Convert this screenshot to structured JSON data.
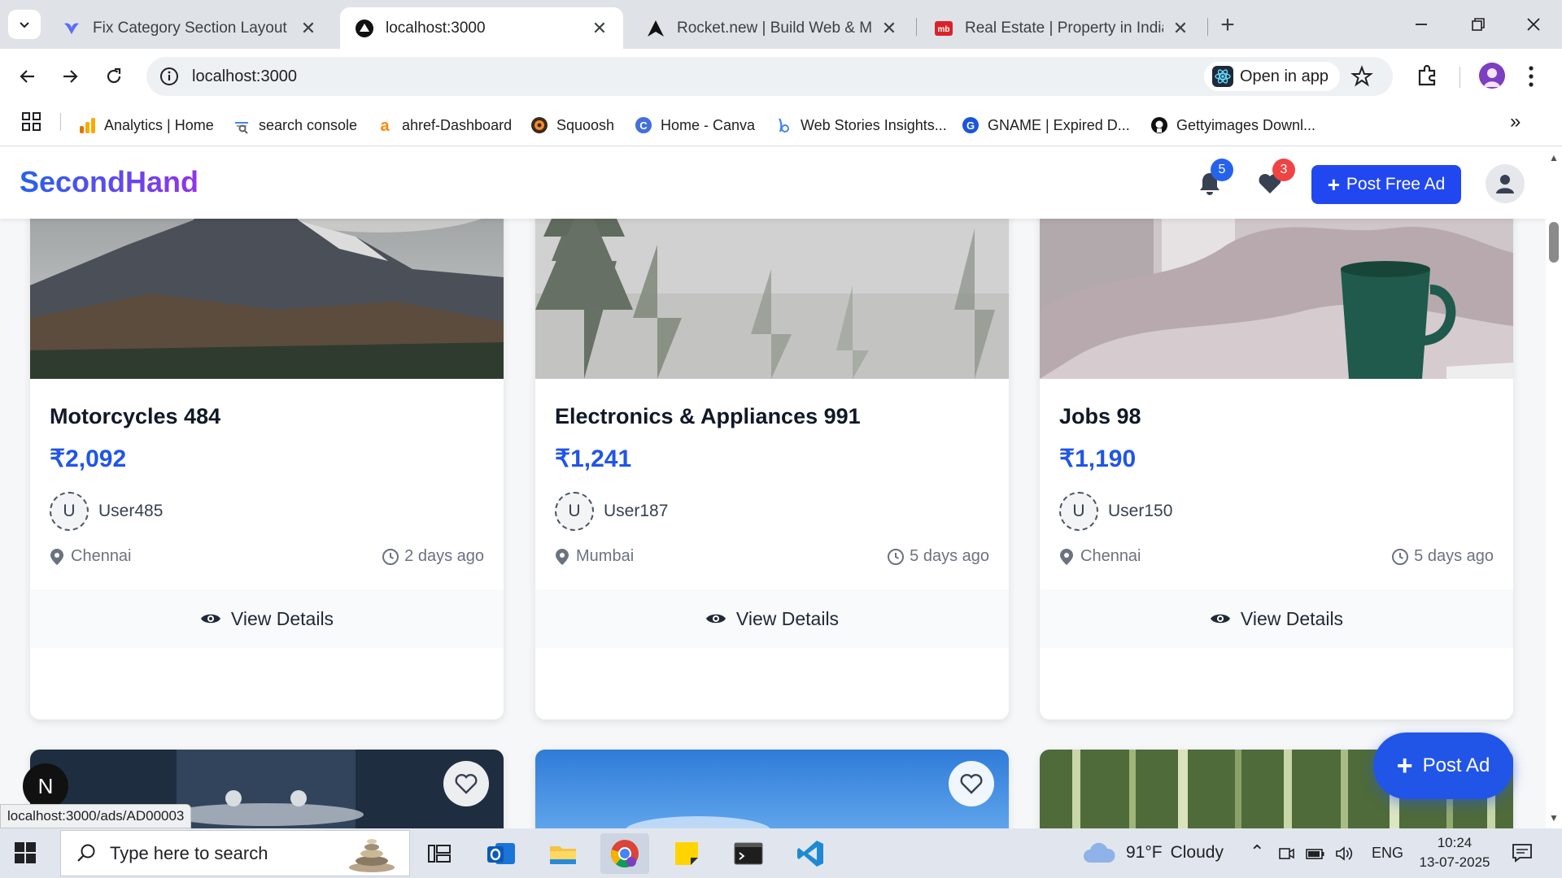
{
  "browser": {
    "tabs": [
      {
        "title": "Fix Category Section Layout and",
        "active": false
      },
      {
        "title": "localhost:3000",
        "active": true
      },
      {
        "title": "Rocket.new | Build Web & Mobile",
        "active": false
      },
      {
        "title": "Real Estate | Property in India | P",
        "active": false
      }
    ],
    "url": "localhost:3000",
    "open_in_app_label": "Open in app",
    "bookmarks": [
      {
        "label": "Analytics | Home"
      },
      {
        "label": "search console"
      },
      {
        "label": "ahref-Dashboard"
      },
      {
        "label": "Squoosh"
      },
      {
        "label": "Home - Canva"
      },
      {
        "label": "Web Stories Insights..."
      },
      {
        "label": "GNAME | Expired D..."
      },
      {
        "label": "Gettyimages Downl..."
      }
    ],
    "status_url": "localhost:3000/ads/AD00003"
  },
  "site": {
    "logo": "SecondHand",
    "notifications_count": "5",
    "favorites_count": "3",
    "post_free_ad_label": "Post Free Ad",
    "post_ad_label": "Post Ad",
    "next_indicator": "N",
    "colors": {
      "primary": "#2155e8",
      "button": "#2148f0",
      "notif_badge": "#2563eb",
      "fav_badge": "#ef4444"
    }
  },
  "listings": [
    {
      "title": "Motorcycles 484",
      "price": "₹2,092",
      "seller_initial": "U",
      "seller": "User485",
      "location": "Chennai",
      "age": "2 days ago",
      "image": "mountain-peak",
      "view_label": "View Details"
    },
    {
      "title": "Electronics & Appliances 991",
      "price": "₹1,241",
      "seller_initial": "U",
      "seller": "User187",
      "location": "Mumbai",
      "age": "5 days ago",
      "image": "foggy-forest",
      "view_label": "View Details"
    },
    {
      "title": "Jobs 98",
      "price": "₹1,190",
      "seller_initial": "U",
      "seller": "User150",
      "location": "Chennai",
      "age": "5 days ago",
      "image": "coffee-mug-bed",
      "view_label": "View Details"
    }
  ],
  "next_row_images": [
    "dark-interior",
    "blue-sky",
    "bamboo-forest"
  ],
  "taskbar": {
    "search_placeholder": "Type here to search",
    "weather_temp": "91°F",
    "weather_desc": "Cloudy",
    "language": "ENG",
    "time": "10:24",
    "date": "13-07-2025"
  }
}
